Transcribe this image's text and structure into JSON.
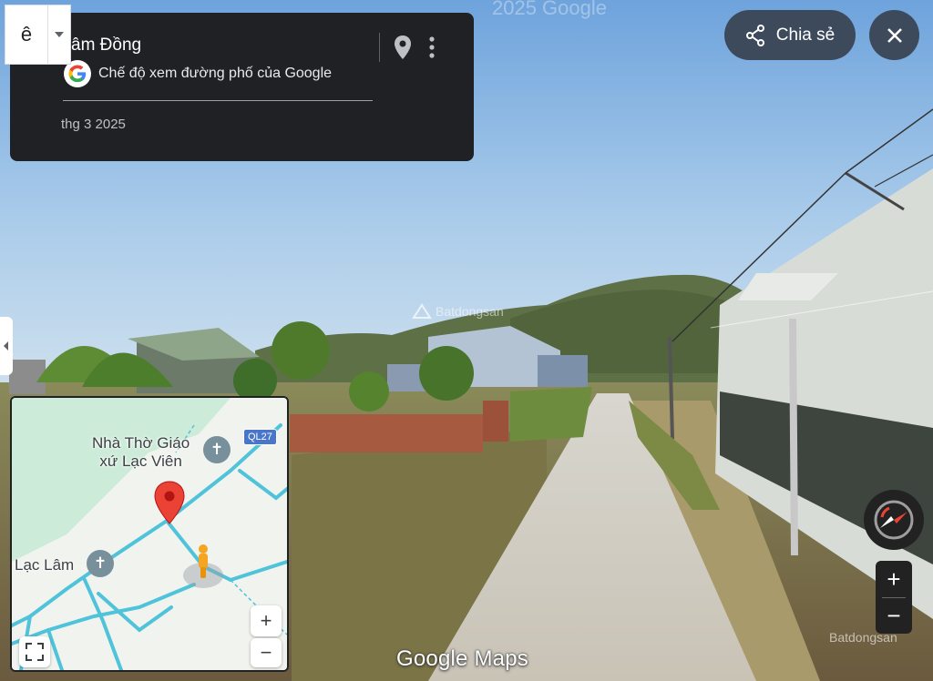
{
  "info_card": {
    "title": "âm Đồng",
    "subtitle": "Chế độ xem đường phố của Google",
    "date": "thg 3 2025"
  },
  "lang_dropdown": {
    "value": "ê"
  },
  "share_button": {
    "label": "Chia sẻ"
  },
  "minimap": {
    "labels": {
      "church1_line1": "Nhà Thờ Giáo",
      "church1_line2": "xứ Lạc Viên",
      "church2": "Lạc Lâm",
      "road_shield": "QL27"
    },
    "zoom_in": "+",
    "zoom_out": "−"
  },
  "zoom": {
    "in": "+",
    "out": "−"
  },
  "footer": {
    "logo_text": "Google Maps"
  },
  "watermarks": {
    "top": "2025 Google",
    "mid": "Batdongsan",
    "bottom_right": "Batdongsan"
  },
  "colors": {
    "panel_bg": "#202124",
    "button_bg": "#3c4a5c",
    "map_road": "#4fc3d9",
    "map_pin": "#ea4335",
    "pegman": "#f4a623"
  },
  "icons": {
    "pin": "location-pin-icon",
    "more": "more-vert-icon",
    "share": "share-icon",
    "close": "close-icon",
    "compass": "compass-icon",
    "fullscreen": "fullscreen-icon"
  }
}
